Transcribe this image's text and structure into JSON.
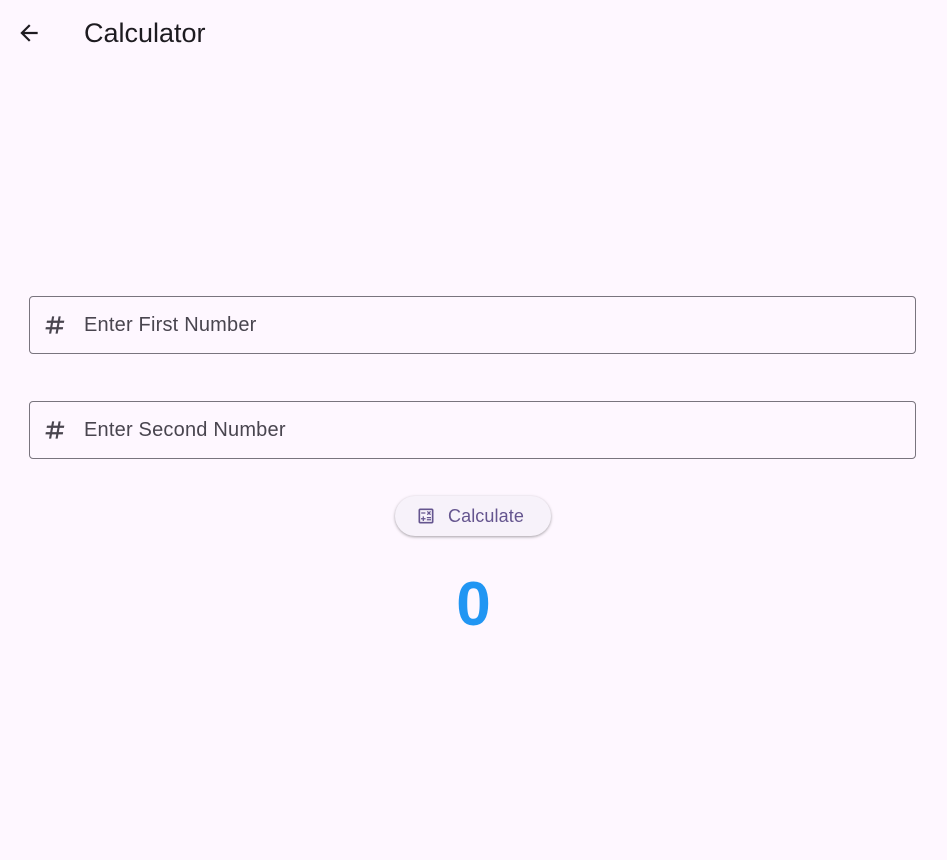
{
  "app_bar": {
    "title": "Calculator",
    "back_icon": "arrow-back-icon"
  },
  "form": {
    "first_number": {
      "placeholder": "Enter First Number",
      "value": "",
      "icon": "hash-icon"
    },
    "second_number": {
      "placeholder": "Enter Second Number",
      "value": "",
      "icon": "hash-icon"
    }
  },
  "calculate_button": {
    "label": "Calculate",
    "icon": "calculate-icon"
  },
  "result": {
    "value": "0"
  },
  "colors": {
    "background": "#fef7ff",
    "primary": "#65558f",
    "result": "#2196f3",
    "outline": "#79747e",
    "on_surface": "#1d1b20",
    "on_surface_variant": "#49454f"
  }
}
